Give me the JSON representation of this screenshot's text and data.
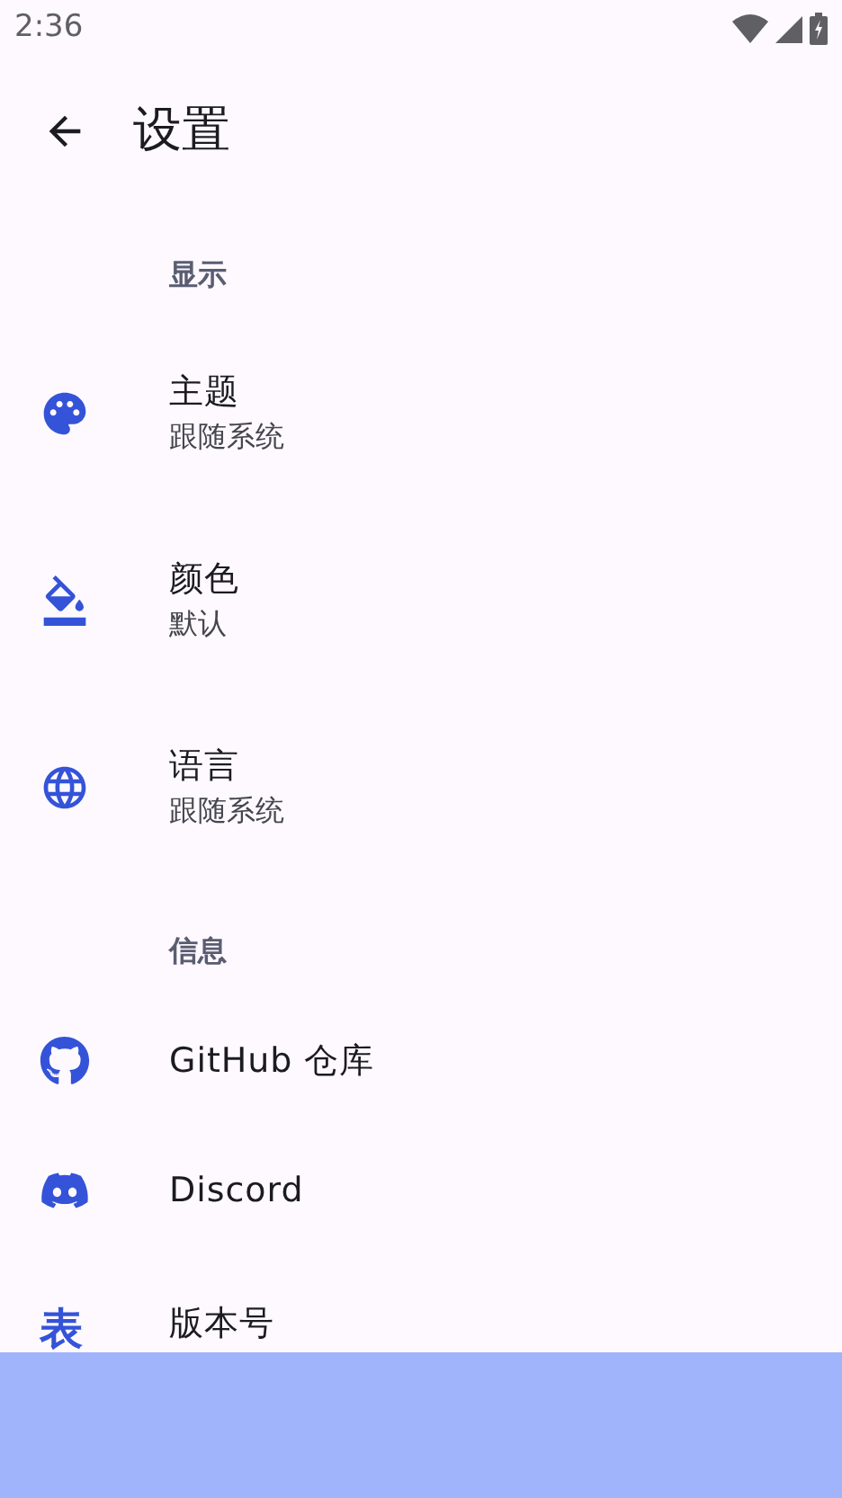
{
  "status_bar": {
    "time": "2:36"
  },
  "top_bar": {
    "title": "设置"
  },
  "sections": [
    {
      "header": "显示",
      "items": [
        {
          "kind": "two_line",
          "title": "主题",
          "subtitle": "跟随系统"
        },
        {
          "kind": "two_line",
          "title": "颜色",
          "subtitle": "默认"
        },
        {
          "kind": "two_line",
          "title": "语言",
          "subtitle": "跟随系统"
        }
      ]
    },
    {
      "header": "信息",
      "items": [
        {
          "kind": "one_line",
          "title": "GitHub 仓库"
        },
        {
          "kind": "one_line",
          "title": "Discord"
        },
        {
          "kind": "glyph_icon",
          "glyph": "表",
          "title": "版本号"
        }
      ]
    }
  ]
}
